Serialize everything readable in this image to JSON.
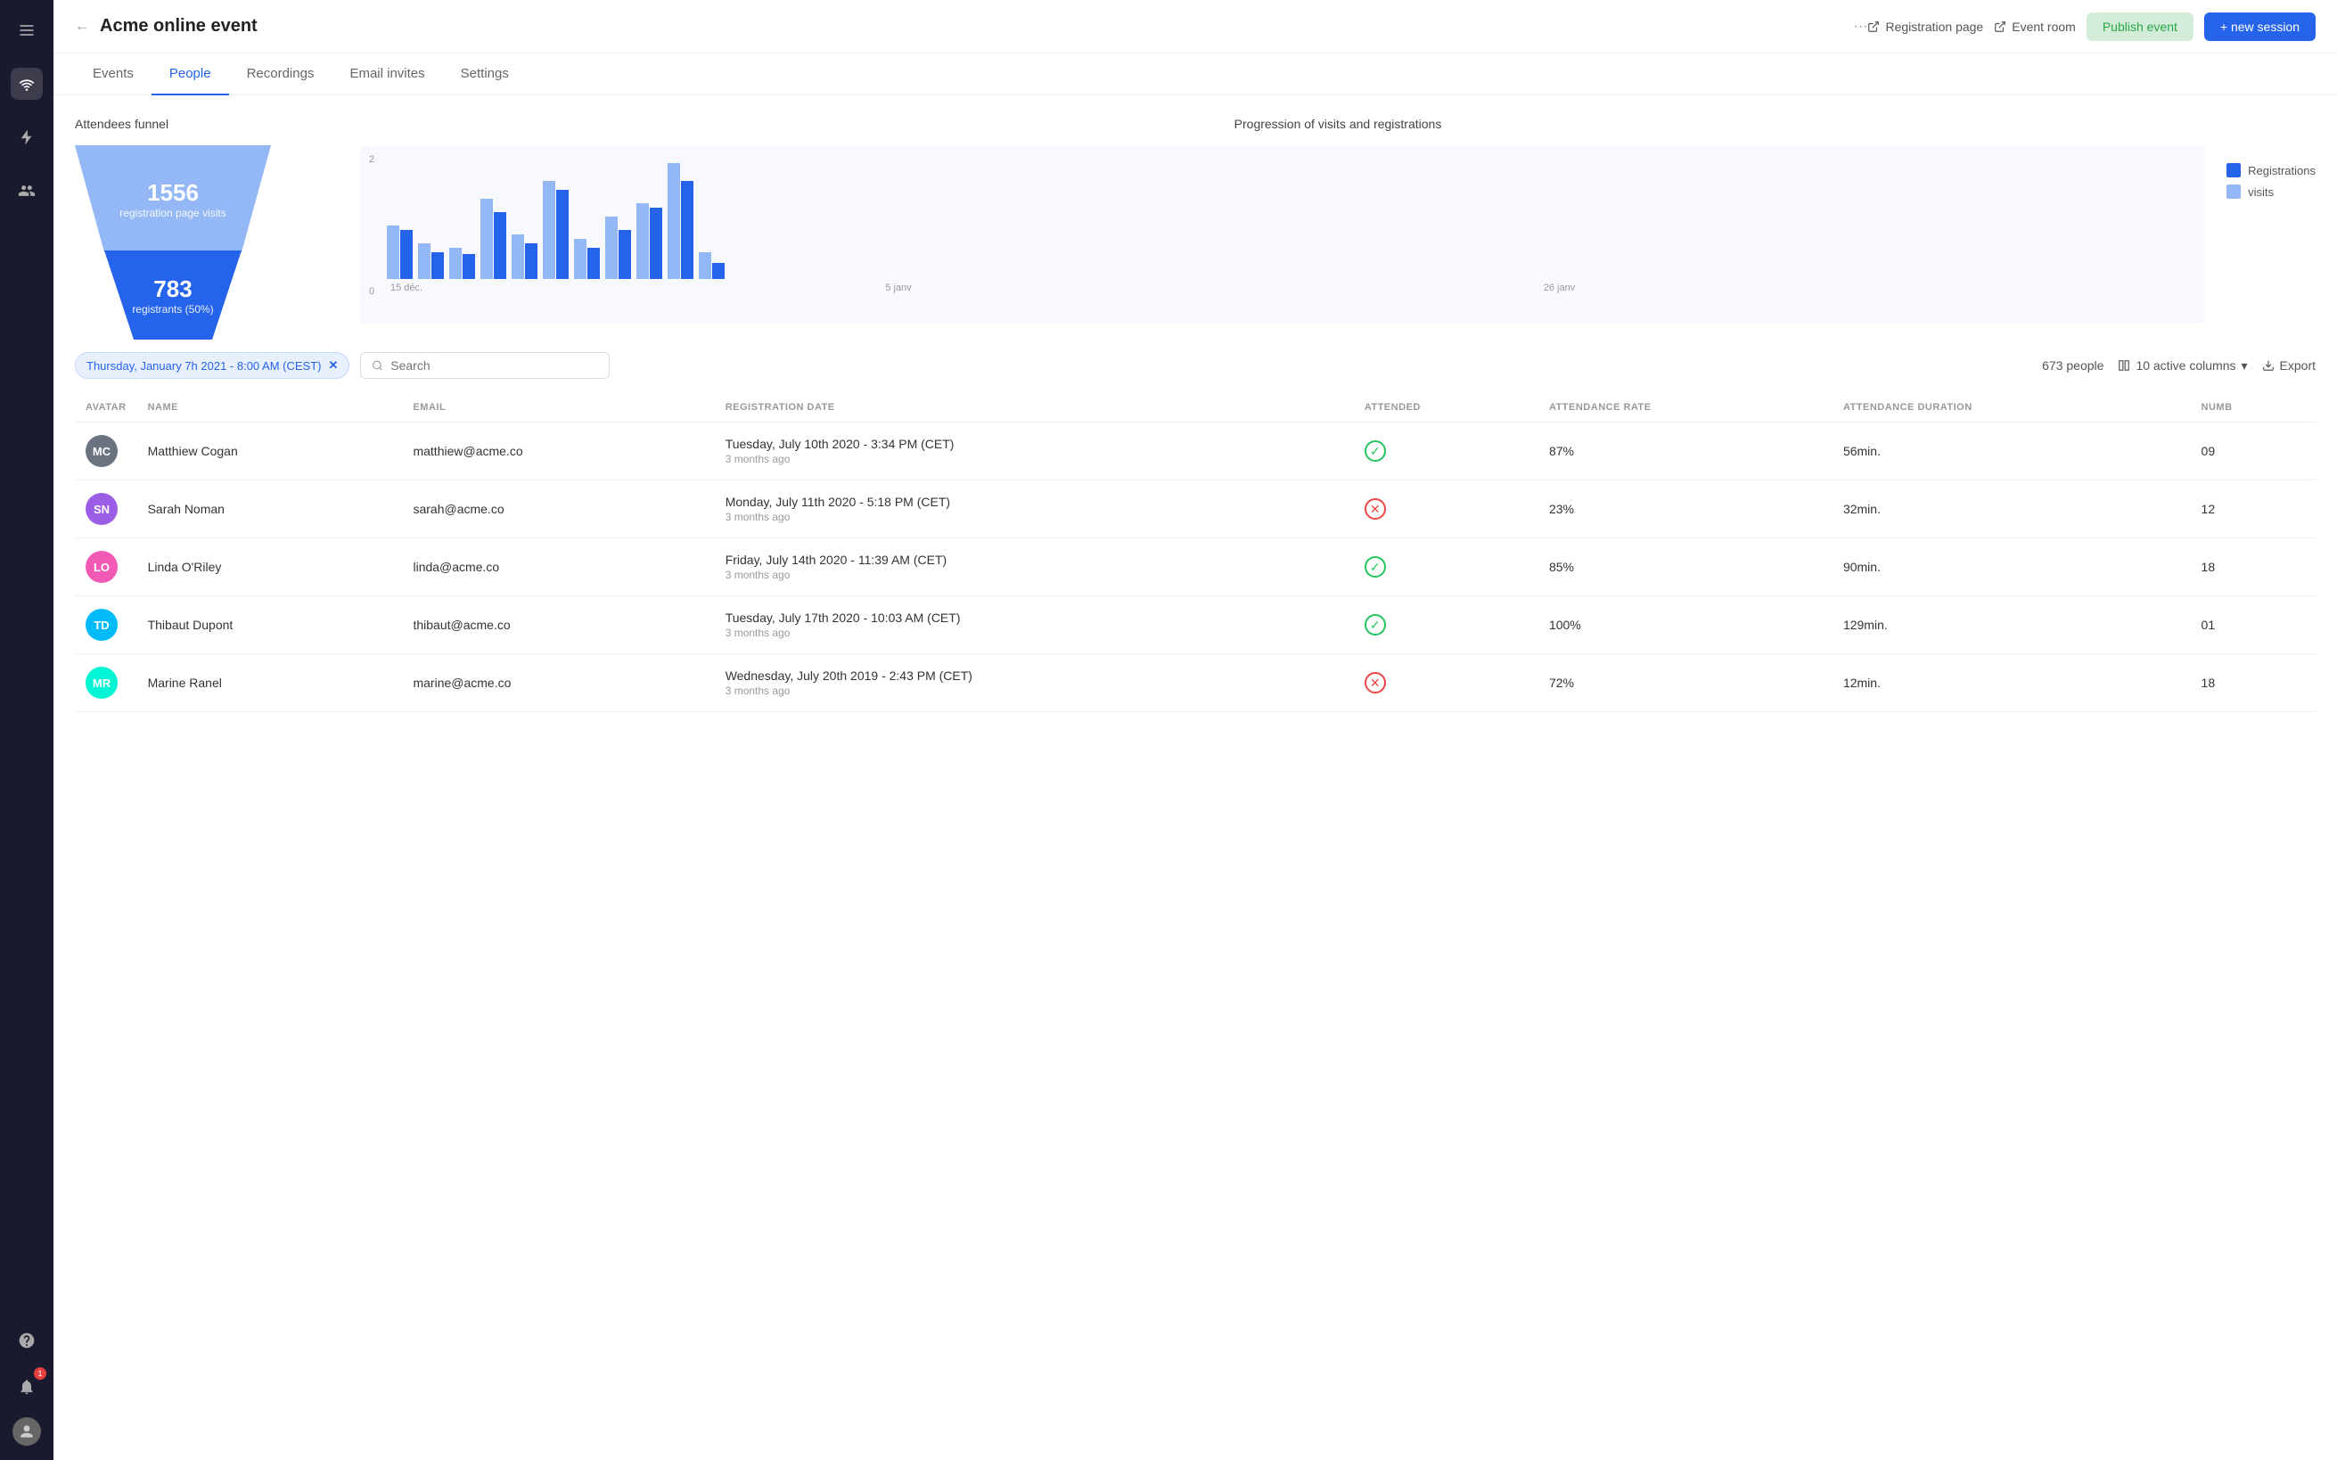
{
  "sidebar": {
    "icons": [
      "menu",
      "wifi",
      "lightning",
      "people"
    ]
  },
  "topbar": {
    "back_label": "←",
    "title": "Acme online event",
    "more_label": "···",
    "registration_page_label": "Registration page",
    "event_room_label": "Event room",
    "publish_label": "Publish event",
    "new_session_label": "+ new session"
  },
  "tabs": [
    {
      "label": "Events",
      "active": false
    },
    {
      "label": "People",
      "active": true
    },
    {
      "label": "Recordings",
      "active": false
    },
    {
      "label": "Email invites",
      "active": false
    },
    {
      "label": "Settings",
      "active": false
    }
  ],
  "funnel": {
    "title": "Attendees funnel",
    "top_number": "1556",
    "top_label": "registration page visits",
    "bottom_number": "783",
    "bottom_label": "registrants (50%)"
  },
  "chart": {
    "title": "Progression of visits and registrations",
    "y_max": "2",
    "y_min": "0",
    "x_labels": [
      "15 déc.",
      "5 janv",
      "26 janv"
    ],
    "legend_registrations": "Registrations",
    "legend_visits": "visits",
    "bars": [
      {
        "visit": 60,
        "reg": 55
      },
      {
        "visit": 40,
        "reg": 30
      },
      {
        "visit": 35,
        "reg": 28
      },
      {
        "visit": 90,
        "reg": 75
      },
      {
        "visit": 50,
        "reg": 40
      },
      {
        "visit": 110,
        "reg": 100
      },
      {
        "visit": 45,
        "reg": 35
      },
      {
        "visit": 70,
        "reg": 55
      },
      {
        "visit": 85,
        "reg": 80
      },
      {
        "visit": 130,
        "reg": 110
      },
      {
        "visit": 30,
        "reg": 18
      }
    ]
  },
  "table_toolbar": {
    "filter_label": "Thursday, January 7h 2021 - 8:00 AM (CEST)",
    "search_placeholder": "Search",
    "people_count": "673 people",
    "columns_label": "10 active columns",
    "export_label": "Export"
  },
  "table": {
    "columns": [
      "AVATAR",
      "NAME",
      "EMAIL",
      "REGISTRATION DATE",
      "ATTENDED",
      "ATTENDANCE RATE",
      "ATTENDANCE DURATION",
      "NUMB"
    ],
    "rows": [
      {
        "name": "Matthiew Cogan",
        "email": "matthiew@acme.co",
        "reg_date": "Tuesday, July 10th 2020 - 3:34 PM (CET)",
        "reg_ago": "3 months ago",
        "attended": true,
        "rate": "87%",
        "duration": "56min.",
        "num": "09"
      },
      {
        "name": "Sarah Noman",
        "email": "sarah@acme.co",
        "reg_date": "Monday, July 11th 2020 - 5:18 PM (CET)",
        "reg_ago": "3 months ago",
        "attended": false,
        "rate": "23%",
        "duration": "32min.",
        "num": "12"
      },
      {
        "name": "Linda O'Riley",
        "email": "linda@acme.co",
        "reg_date": "Friday, July 14th 2020 - 11:39 AM (CET)",
        "reg_ago": "3 months ago",
        "attended": true,
        "rate": "85%",
        "duration": "90min.",
        "num": "18"
      },
      {
        "name": "Thibaut Dupont",
        "email": "thibaut@acme.co",
        "reg_date": "Tuesday, July 17th 2020 - 10:03 AM (CET)",
        "reg_ago": "3 months ago",
        "attended": true,
        "rate": "100%",
        "duration": "129min.",
        "num": "01"
      },
      {
        "name": "Marine Ranel",
        "email": "marine@acme.co",
        "reg_date": "Wednesday, July 20th 2019 - 2:43 PM (CET)",
        "reg_ago": "3 months ago",
        "attended": false,
        "rate": "72%",
        "duration": "12min.",
        "num": "18"
      }
    ]
  }
}
